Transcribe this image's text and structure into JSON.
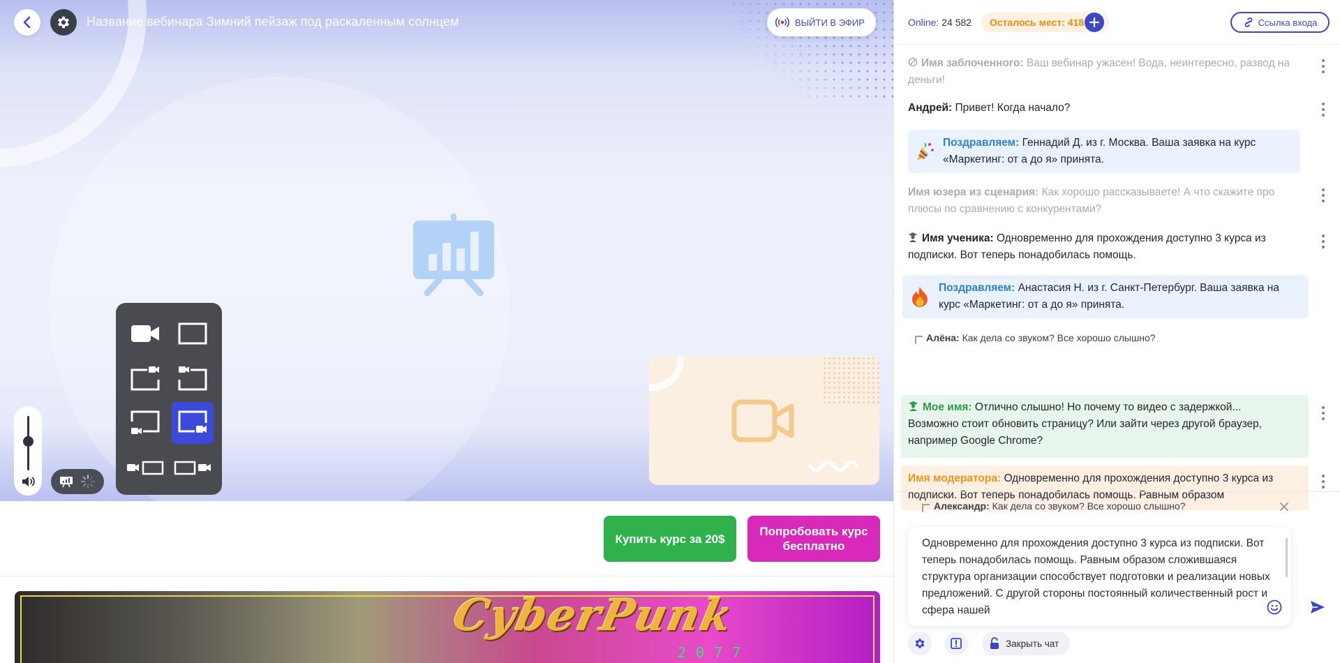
{
  "header": {
    "title": "Название вебинара Зимний пейзаж под раскаленным солнцем",
    "live_button": "ВЫЙТИ В ЭФИР"
  },
  "icons": {
    "back": "chevron-left-icon",
    "settings": "gear-icon",
    "live": "broadcast-icon",
    "presentation": "presentation-chart-icon",
    "camera": "video-camera-icon",
    "volume": "speaker-icon"
  },
  "layouts": [
    {
      "name": "camera-only"
    },
    {
      "name": "screen-only"
    },
    {
      "name": "screen-camera-top-right"
    },
    {
      "name": "screen-camera-top-left"
    },
    {
      "name": "screen-camera-bottom-left"
    },
    {
      "name": "screen-camera-bottom-right",
      "active": true
    },
    {
      "name": "camera-left-screen"
    },
    {
      "name": "screen-camera-right"
    }
  ],
  "cta": {
    "buy": "Купить курс за 20$",
    "try": "Попробовать курс бесплатно"
  },
  "banner": {
    "logo": "CyberPunk",
    "year": "2077"
  },
  "chat": {
    "online_label": "Online:",
    "online_count": "24 582",
    "seats_label": "Осталось мест:",
    "seats_count": "418",
    "link_button": "Ссылка входа",
    "messages": [
      {
        "name": "Имя заблоченного:",
        "text": "Ваш вебинар ужасен! Вода, неинтересно, развод на деньги!"
      },
      {
        "name": "Андрей:",
        "text": "Привет! Когда начало?"
      },
      {
        "name": "Поздравляем:",
        "text": "Геннадий Д. из г. Москва. Ваша заявка на курс «Маркетинг: от а до я» принята."
      },
      {
        "name": "Имя юзера из сценария:",
        "text": "Как хорошо рассказываете! А что скажите про плюсы по сравнению с конкурентами?"
      },
      {
        "name": "Имя ученика:",
        "text": "Одновременно для прохождения доступно 3 курса из подписки. Вот теперь понадобилась помощь."
      },
      {
        "name": "Поздравляем:",
        "text": "Анастасия Н. из г. Санкт-Петербург. Ваша заявка на курс «Маркетинг: от а до я» принята."
      },
      {
        "reply_name": "Алёна:",
        "reply_text": "Как дела со звуком? Все хорошо слышно?"
      },
      {
        "name": "Мое имя:",
        "text": "Отлично слышно! Но почему то видео с задержкой... Возможно стоит обновить страницу? Или зайти через другой браузер, например Google Chrome?"
      },
      {
        "name": "Имя модератора:",
        "text": "Одновременно для прохождения доступно 3 курса из подписки. Вот теперь понадобилась помощь. Равным образом"
      }
    ],
    "compose": {
      "reply_name": "Александр:",
      "reply_text": "Как дела со звуком? Все хорошо слышно?",
      "text": "Одновременно для прохождения доступно 3 курса из подписки. Вот теперь понадобилась помощь. Равным образом сложившаяся структура организации способствует подготовки и реализации новых предложений. С другой стороны постоянный количественный рост и сфера нашей",
      "close_chat": "Закрыть чат"
    }
  },
  "colors": {
    "accent": "#3a48c8",
    "buy": "#2fb24c",
    "try": "#d829ba",
    "seats": "#f08a12",
    "congrats": "#2f80d0",
    "mine": "#2a9c4a",
    "moderator": "#f0941e"
  }
}
